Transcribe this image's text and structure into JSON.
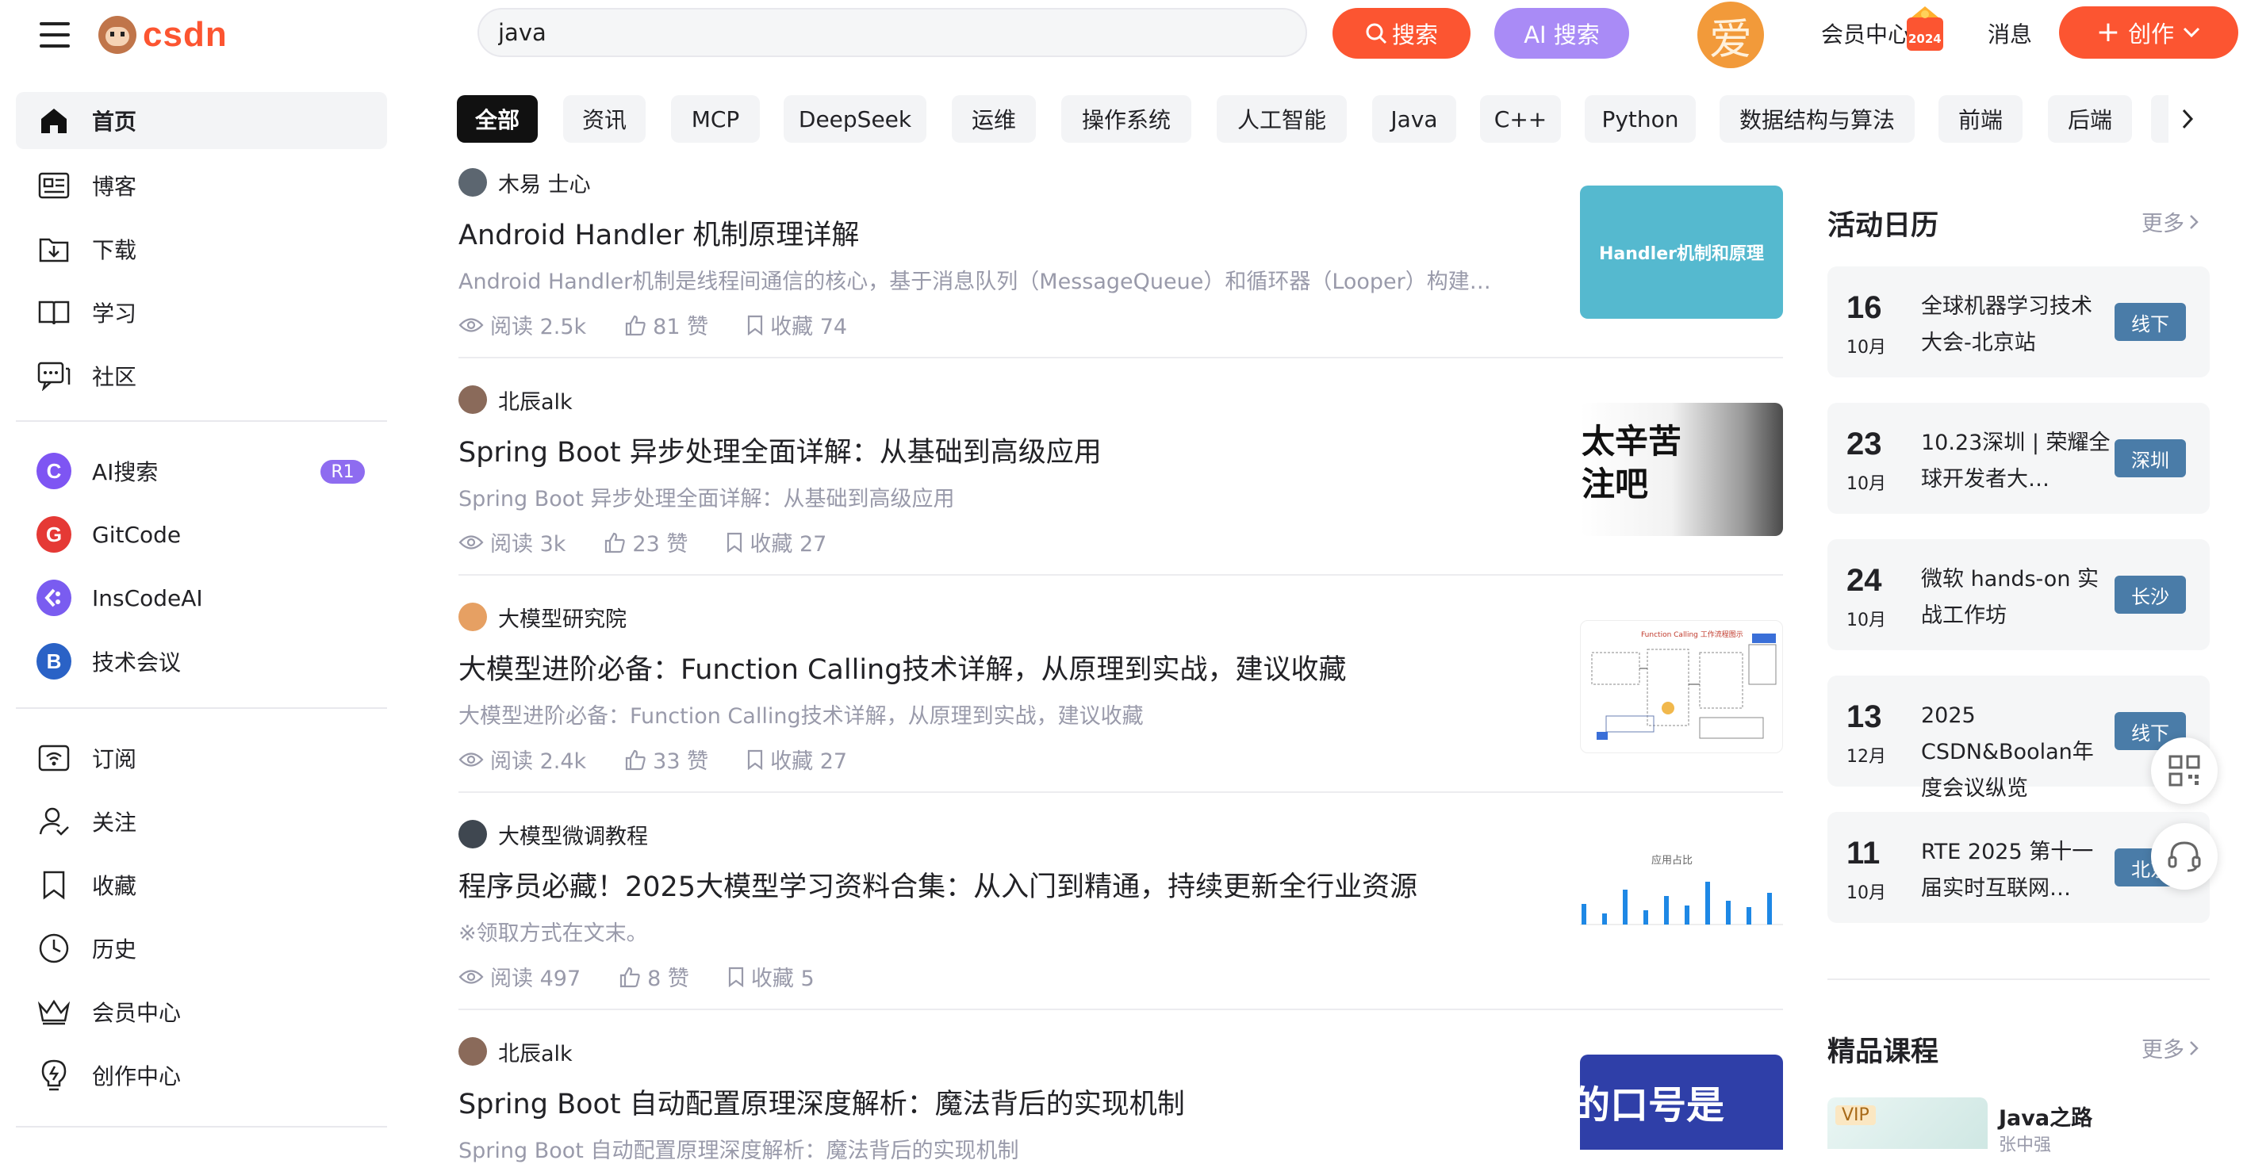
{
  "header": {
    "logo_text": "csdn",
    "search_value": "java",
    "search_button": "搜索",
    "ai_search_button": "AI 搜索",
    "avatar_char": "爱",
    "vip_center": "会员中心",
    "vip_year": "2024",
    "messages": "消息",
    "create_button": "创作"
  },
  "sidebar": {
    "main": [
      {
        "label": "首页",
        "icon": "home-icon"
      },
      {
        "label": "博客",
        "icon": "blog-icon"
      },
      {
        "label": "下载",
        "icon": "download-icon"
      },
      {
        "label": "学习",
        "icon": "book-icon"
      },
      {
        "label": "社区",
        "icon": "community-icon"
      }
    ],
    "tools": [
      {
        "label": "AI搜索",
        "badge": "R1",
        "letter": "C",
        "color": "#7e55f3"
      },
      {
        "label": "GitCode",
        "letter": "G",
        "color": "#e53935"
      },
      {
        "label": "InsCodeAI",
        "letter": "",
        "color": "#7a5cf0"
      },
      {
        "label": "技术会议",
        "letter": "B",
        "color": "#2a62c6"
      }
    ],
    "personal": [
      {
        "label": "订阅",
        "icon": "subscribe-icon"
      },
      {
        "label": "关注",
        "icon": "follow-icon"
      },
      {
        "label": "收藏",
        "icon": "bookmark-icon"
      },
      {
        "label": "历史",
        "icon": "history-icon"
      },
      {
        "label": "会员中心",
        "icon": "crown-icon"
      },
      {
        "label": "创作中心",
        "icon": "bulb-icon"
      }
    ]
  },
  "categories": [
    "全部",
    "资讯",
    "MCP",
    "DeepSeek",
    "运维",
    "操作系统",
    "人工智能",
    "Java",
    "C++",
    "Python",
    "数据结构与算法",
    "前端",
    "后端"
  ],
  "articles": [
    {
      "author": "木易 士心",
      "title": "Android Handler 机制原理详解",
      "summary": "Android Handler机制是线程间通信的核心，基于消息队列（MessageQueue）和循环器（Looper）构建…",
      "reads": "阅读 2.5k",
      "likes": "81 赞",
      "favs": "收藏 74",
      "thumb_text": "Handler机制和原理"
    },
    {
      "author": "北辰alk",
      "title": "Spring Boot 异步处理全面详解：从基础到高级应用",
      "summary": "Spring Boot 异步处理全面详解：从基础到高级应用",
      "reads": "阅读 3k",
      "likes": "23 赞",
      "favs": "收藏 27",
      "thumb_text": "太辛苦\n注吧"
    },
    {
      "author": "大模型研究院",
      "title": "大模型进阶必备：Function Calling技术详解，从原理到实战，建议收藏",
      "summary": "大模型进阶必备：Function Calling技术详解，从原理到实战，建议收藏",
      "reads": "阅读 2.4k",
      "likes": "33 赞",
      "favs": "收藏 27",
      "thumb_text": "Function Calling 工作流程图示"
    },
    {
      "author": "大模型微调教程",
      "title": "程序员必藏！2025大模型学习资料合集：从入门到精通，持续更新全行业资源",
      "summary": "※领取方式在文末。",
      "reads": "阅读 497",
      "likes": "8 赞",
      "favs": "收藏 5",
      "thumb_text": "应用占比"
    },
    {
      "author": "北辰alk",
      "title": "Spring Boot 自动配置原理深度解析：魔法背后的实现机制",
      "summary": "Spring Boot 自动配置原理深度解析：魔法背后的实现机制",
      "reads": "",
      "likes": "",
      "favs": "",
      "thumb_text": "的口号是"
    }
  ],
  "calendar": {
    "title": "活动日历",
    "more": "更多",
    "events": [
      {
        "day": "16",
        "month": "10月",
        "title": "全球机器学习技术大会-北京站",
        "tag": "线下"
      },
      {
        "day": "23",
        "month": "10月",
        "title": "10.23深圳 | 荣耀全球开发者大…",
        "tag": "深圳"
      },
      {
        "day": "24",
        "month": "10月",
        "title": "微软 hands-on 实战工作坊",
        "tag": "长沙"
      },
      {
        "day": "13",
        "month": "12月",
        "title": "2025 CSDN&Boolan年度会议纵览",
        "tag": "线下"
      },
      {
        "day": "11",
        "month": "10月",
        "title": "RTE 2025 第十一届实时互联网…",
        "tag": "北京"
      }
    ]
  },
  "courses": {
    "title": "精品课程",
    "more": "更多",
    "item": {
      "badge": "VIP",
      "name": "Java之路",
      "teacher": "张中强"
    }
  }
}
